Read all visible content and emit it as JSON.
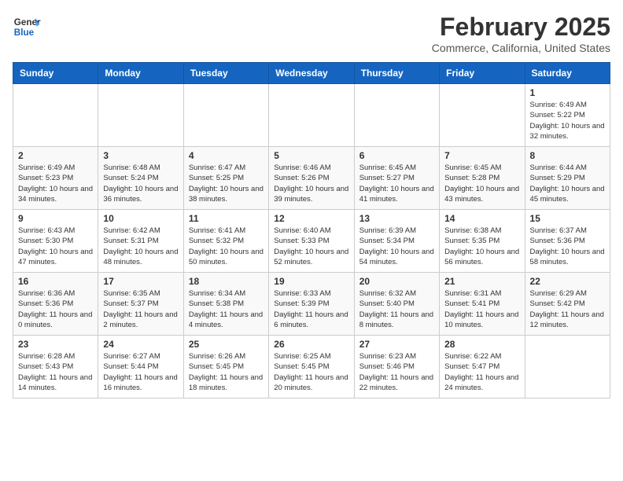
{
  "header": {
    "logo_general": "General",
    "logo_blue": "Blue",
    "month": "February 2025",
    "location": "Commerce, California, United States"
  },
  "days_of_week": [
    "Sunday",
    "Monday",
    "Tuesday",
    "Wednesday",
    "Thursday",
    "Friday",
    "Saturday"
  ],
  "weeks": [
    [
      {
        "day": "",
        "info": ""
      },
      {
        "day": "",
        "info": ""
      },
      {
        "day": "",
        "info": ""
      },
      {
        "day": "",
        "info": ""
      },
      {
        "day": "",
        "info": ""
      },
      {
        "day": "",
        "info": ""
      },
      {
        "day": "1",
        "info": "Sunrise: 6:49 AM\nSunset: 5:22 PM\nDaylight: 10 hours and 32 minutes."
      }
    ],
    [
      {
        "day": "2",
        "info": "Sunrise: 6:49 AM\nSunset: 5:23 PM\nDaylight: 10 hours and 34 minutes."
      },
      {
        "day": "3",
        "info": "Sunrise: 6:48 AM\nSunset: 5:24 PM\nDaylight: 10 hours and 36 minutes."
      },
      {
        "day": "4",
        "info": "Sunrise: 6:47 AM\nSunset: 5:25 PM\nDaylight: 10 hours and 38 minutes."
      },
      {
        "day": "5",
        "info": "Sunrise: 6:46 AM\nSunset: 5:26 PM\nDaylight: 10 hours and 39 minutes."
      },
      {
        "day": "6",
        "info": "Sunrise: 6:45 AM\nSunset: 5:27 PM\nDaylight: 10 hours and 41 minutes."
      },
      {
        "day": "7",
        "info": "Sunrise: 6:45 AM\nSunset: 5:28 PM\nDaylight: 10 hours and 43 minutes."
      },
      {
        "day": "8",
        "info": "Sunrise: 6:44 AM\nSunset: 5:29 PM\nDaylight: 10 hours and 45 minutes."
      }
    ],
    [
      {
        "day": "9",
        "info": "Sunrise: 6:43 AM\nSunset: 5:30 PM\nDaylight: 10 hours and 47 minutes."
      },
      {
        "day": "10",
        "info": "Sunrise: 6:42 AM\nSunset: 5:31 PM\nDaylight: 10 hours and 48 minutes."
      },
      {
        "day": "11",
        "info": "Sunrise: 6:41 AM\nSunset: 5:32 PM\nDaylight: 10 hours and 50 minutes."
      },
      {
        "day": "12",
        "info": "Sunrise: 6:40 AM\nSunset: 5:33 PM\nDaylight: 10 hours and 52 minutes."
      },
      {
        "day": "13",
        "info": "Sunrise: 6:39 AM\nSunset: 5:34 PM\nDaylight: 10 hours and 54 minutes."
      },
      {
        "day": "14",
        "info": "Sunrise: 6:38 AM\nSunset: 5:35 PM\nDaylight: 10 hours and 56 minutes."
      },
      {
        "day": "15",
        "info": "Sunrise: 6:37 AM\nSunset: 5:36 PM\nDaylight: 10 hours and 58 minutes."
      }
    ],
    [
      {
        "day": "16",
        "info": "Sunrise: 6:36 AM\nSunset: 5:36 PM\nDaylight: 11 hours and 0 minutes."
      },
      {
        "day": "17",
        "info": "Sunrise: 6:35 AM\nSunset: 5:37 PM\nDaylight: 11 hours and 2 minutes."
      },
      {
        "day": "18",
        "info": "Sunrise: 6:34 AM\nSunset: 5:38 PM\nDaylight: 11 hours and 4 minutes."
      },
      {
        "day": "19",
        "info": "Sunrise: 6:33 AM\nSunset: 5:39 PM\nDaylight: 11 hours and 6 minutes."
      },
      {
        "day": "20",
        "info": "Sunrise: 6:32 AM\nSunset: 5:40 PM\nDaylight: 11 hours and 8 minutes."
      },
      {
        "day": "21",
        "info": "Sunrise: 6:31 AM\nSunset: 5:41 PM\nDaylight: 11 hours and 10 minutes."
      },
      {
        "day": "22",
        "info": "Sunrise: 6:29 AM\nSunset: 5:42 PM\nDaylight: 11 hours and 12 minutes."
      }
    ],
    [
      {
        "day": "23",
        "info": "Sunrise: 6:28 AM\nSunset: 5:43 PM\nDaylight: 11 hours and 14 minutes."
      },
      {
        "day": "24",
        "info": "Sunrise: 6:27 AM\nSunset: 5:44 PM\nDaylight: 11 hours and 16 minutes."
      },
      {
        "day": "25",
        "info": "Sunrise: 6:26 AM\nSunset: 5:45 PM\nDaylight: 11 hours and 18 minutes."
      },
      {
        "day": "26",
        "info": "Sunrise: 6:25 AM\nSunset: 5:45 PM\nDaylight: 11 hours and 20 minutes."
      },
      {
        "day": "27",
        "info": "Sunrise: 6:23 AM\nSunset: 5:46 PM\nDaylight: 11 hours and 22 minutes."
      },
      {
        "day": "28",
        "info": "Sunrise: 6:22 AM\nSunset: 5:47 PM\nDaylight: 11 hours and 24 minutes."
      },
      {
        "day": "",
        "info": ""
      }
    ]
  ]
}
